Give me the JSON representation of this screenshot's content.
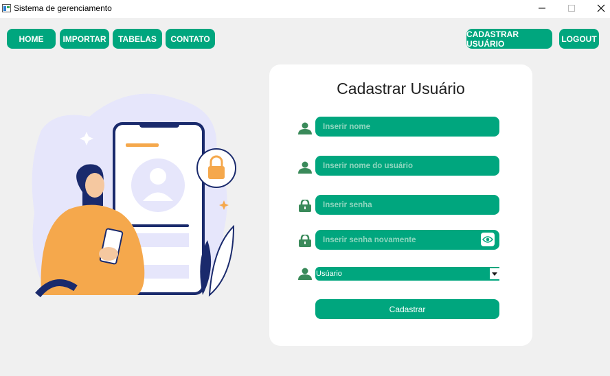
{
  "window": {
    "title": "Sistema de gerenciamento"
  },
  "nav": {
    "home": "HOME",
    "importar": "IMPORTAR",
    "tabelas": "TABELAS",
    "contato": "CONTATO",
    "cadastrar_usuario": "CADASTRAR USUÁRIO",
    "logout": "LOGOUT"
  },
  "form": {
    "title": "Cadastrar Usuário",
    "nome_placeholder": "Inserir nome",
    "usuario_placeholder": "Inserir nome do usuário",
    "senha_placeholder": "Inserir senha",
    "senha2_placeholder": "Inserir senha novamente",
    "tipo_selected": "Usúario",
    "submit_label": "Cadastrar"
  },
  "colors": {
    "accent": "#00a67e",
    "background": "#f0f0f0",
    "card": "#ffffff"
  },
  "icons": [
    "user-icon",
    "lock-icon",
    "eye-icon",
    "dropdown-arrow-icon"
  ]
}
